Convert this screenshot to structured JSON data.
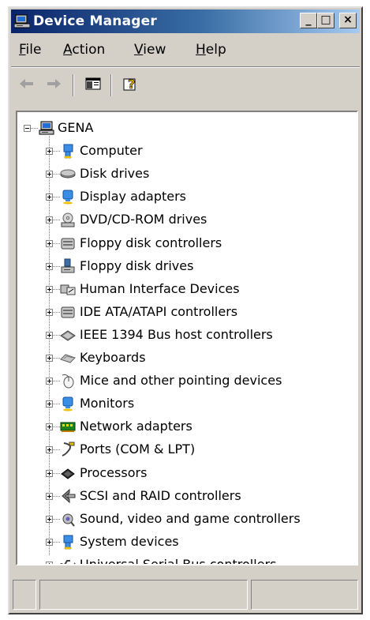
{
  "window": {
    "title": "Device Manager",
    "controls": {
      "minimize": "_",
      "maximize": "□",
      "close": "×"
    }
  },
  "menu": [
    {
      "label": "File",
      "mnemonic": "F",
      "rest": "ile"
    },
    {
      "label": "Action",
      "mnemonic": "A",
      "rest": "ction"
    },
    {
      "label": "View",
      "mnemonic": "V",
      "rest": "iew"
    },
    {
      "label": "Help",
      "mnemonic": "H",
      "rest": "elp"
    }
  ],
  "toolbar": {
    "back_icon": "back-arrow-icon",
    "forward_icon": "forward-arrow-icon",
    "show_hide_console_tree_icon": "console-tree-icon",
    "help_icon": "help-icon"
  },
  "tree": {
    "root": {
      "label": "GENA",
      "icon": "computer-icon",
      "expanded": true
    },
    "items": [
      {
        "label": "Computer",
        "icon": "computer-class-icon"
      },
      {
        "label": "Disk drives",
        "icon": "disk-drive-icon"
      },
      {
        "label": "Display adapters",
        "icon": "display-adapter-icon"
      },
      {
        "label": "DVD/CD-ROM drives",
        "icon": "cdrom-icon"
      },
      {
        "label": "Floppy disk controllers",
        "icon": "floppy-controller-icon"
      },
      {
        "label": "Floppy disk drives",
        "icon": "floppy-drive-icon"
      },
      {
        "label": "Human Interface Devices",
        "icon": "hid-icon"
      },
      {
        "label": "IDE ATA/ATAPI controllers",
        "icon": "ide-controller-icon"
      },
      {
        "label": "IEEE 1394 Bus host controllers",
        "icon": "ieee1394-icon"
      },
      {
        "label": "Keyboards",
        "icon": "keyboard-icon"
      },
      {
        "label": "Mice and other pointing devices",
        "icon": "mouse-icon"
      },
      {
        "label": "Monitors",
        "icon": "monitor-icon"
      },
      {
        "label": "Network adapters",
        "icon": "network-adapter-icon"
      },
      {
        "label": "Ports (COM & LPT)",
        "icon": "port-icon"
      },
      {
        "label": "Processors",
        "icon": "processor-icon"
      },
      {
        "label": "SCSI and RAID controllers",
        "icon": "scsi-icon"
      },
      {
        "label": "Sound, video and game controllers",
        "icon": "sound-icon"
      },
      {
        "label": "System devices",
        "icon": "system-device-icon"
      },
      {
        "label": "Universal Serial Bus controllers",
        "icon": "usb-icon"
      }
    ]
  },
  "statusbar": {
    "panes": [
      "",
      "",
      ""
    ]
  }
}
